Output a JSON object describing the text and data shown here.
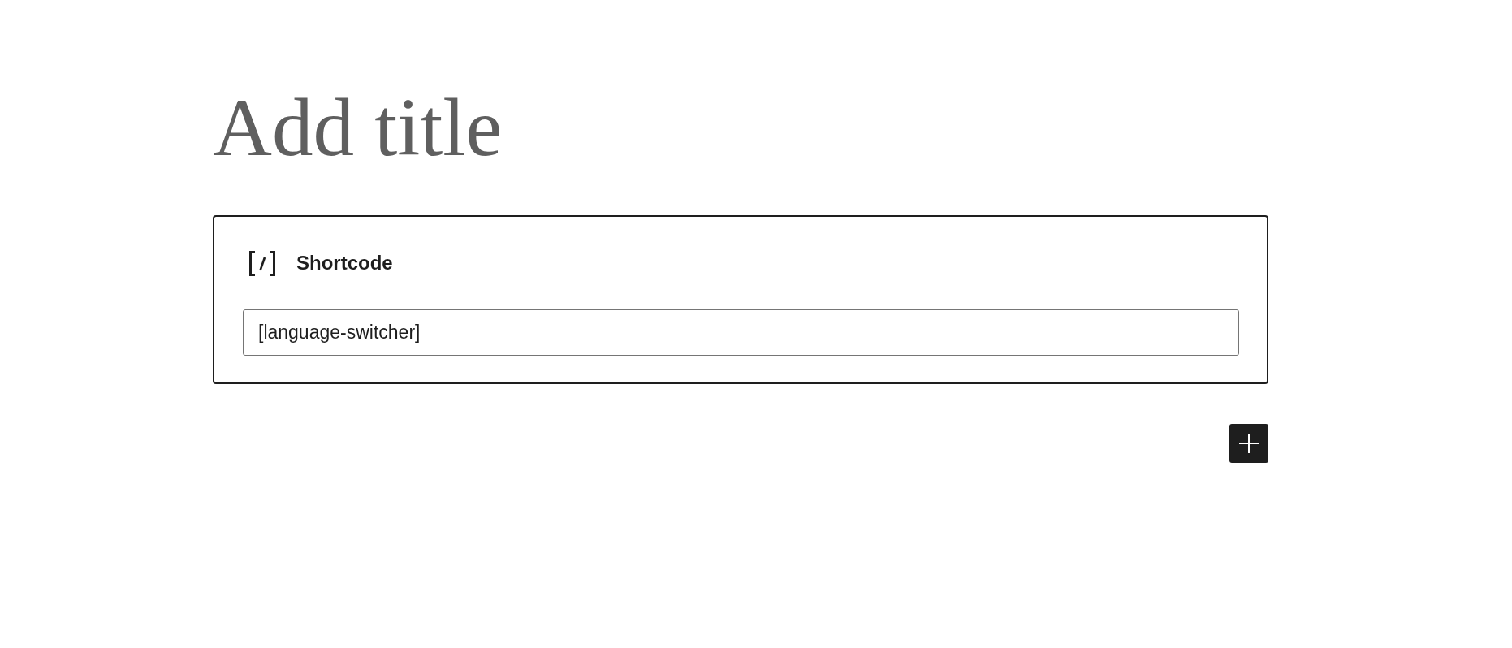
{
  "title": {
    "placeholder": "Add title"
  },
  "block": {
    "name": "Shortcode",
    "input": {
      "value": "[language-switcher]"
    }
  }
}
